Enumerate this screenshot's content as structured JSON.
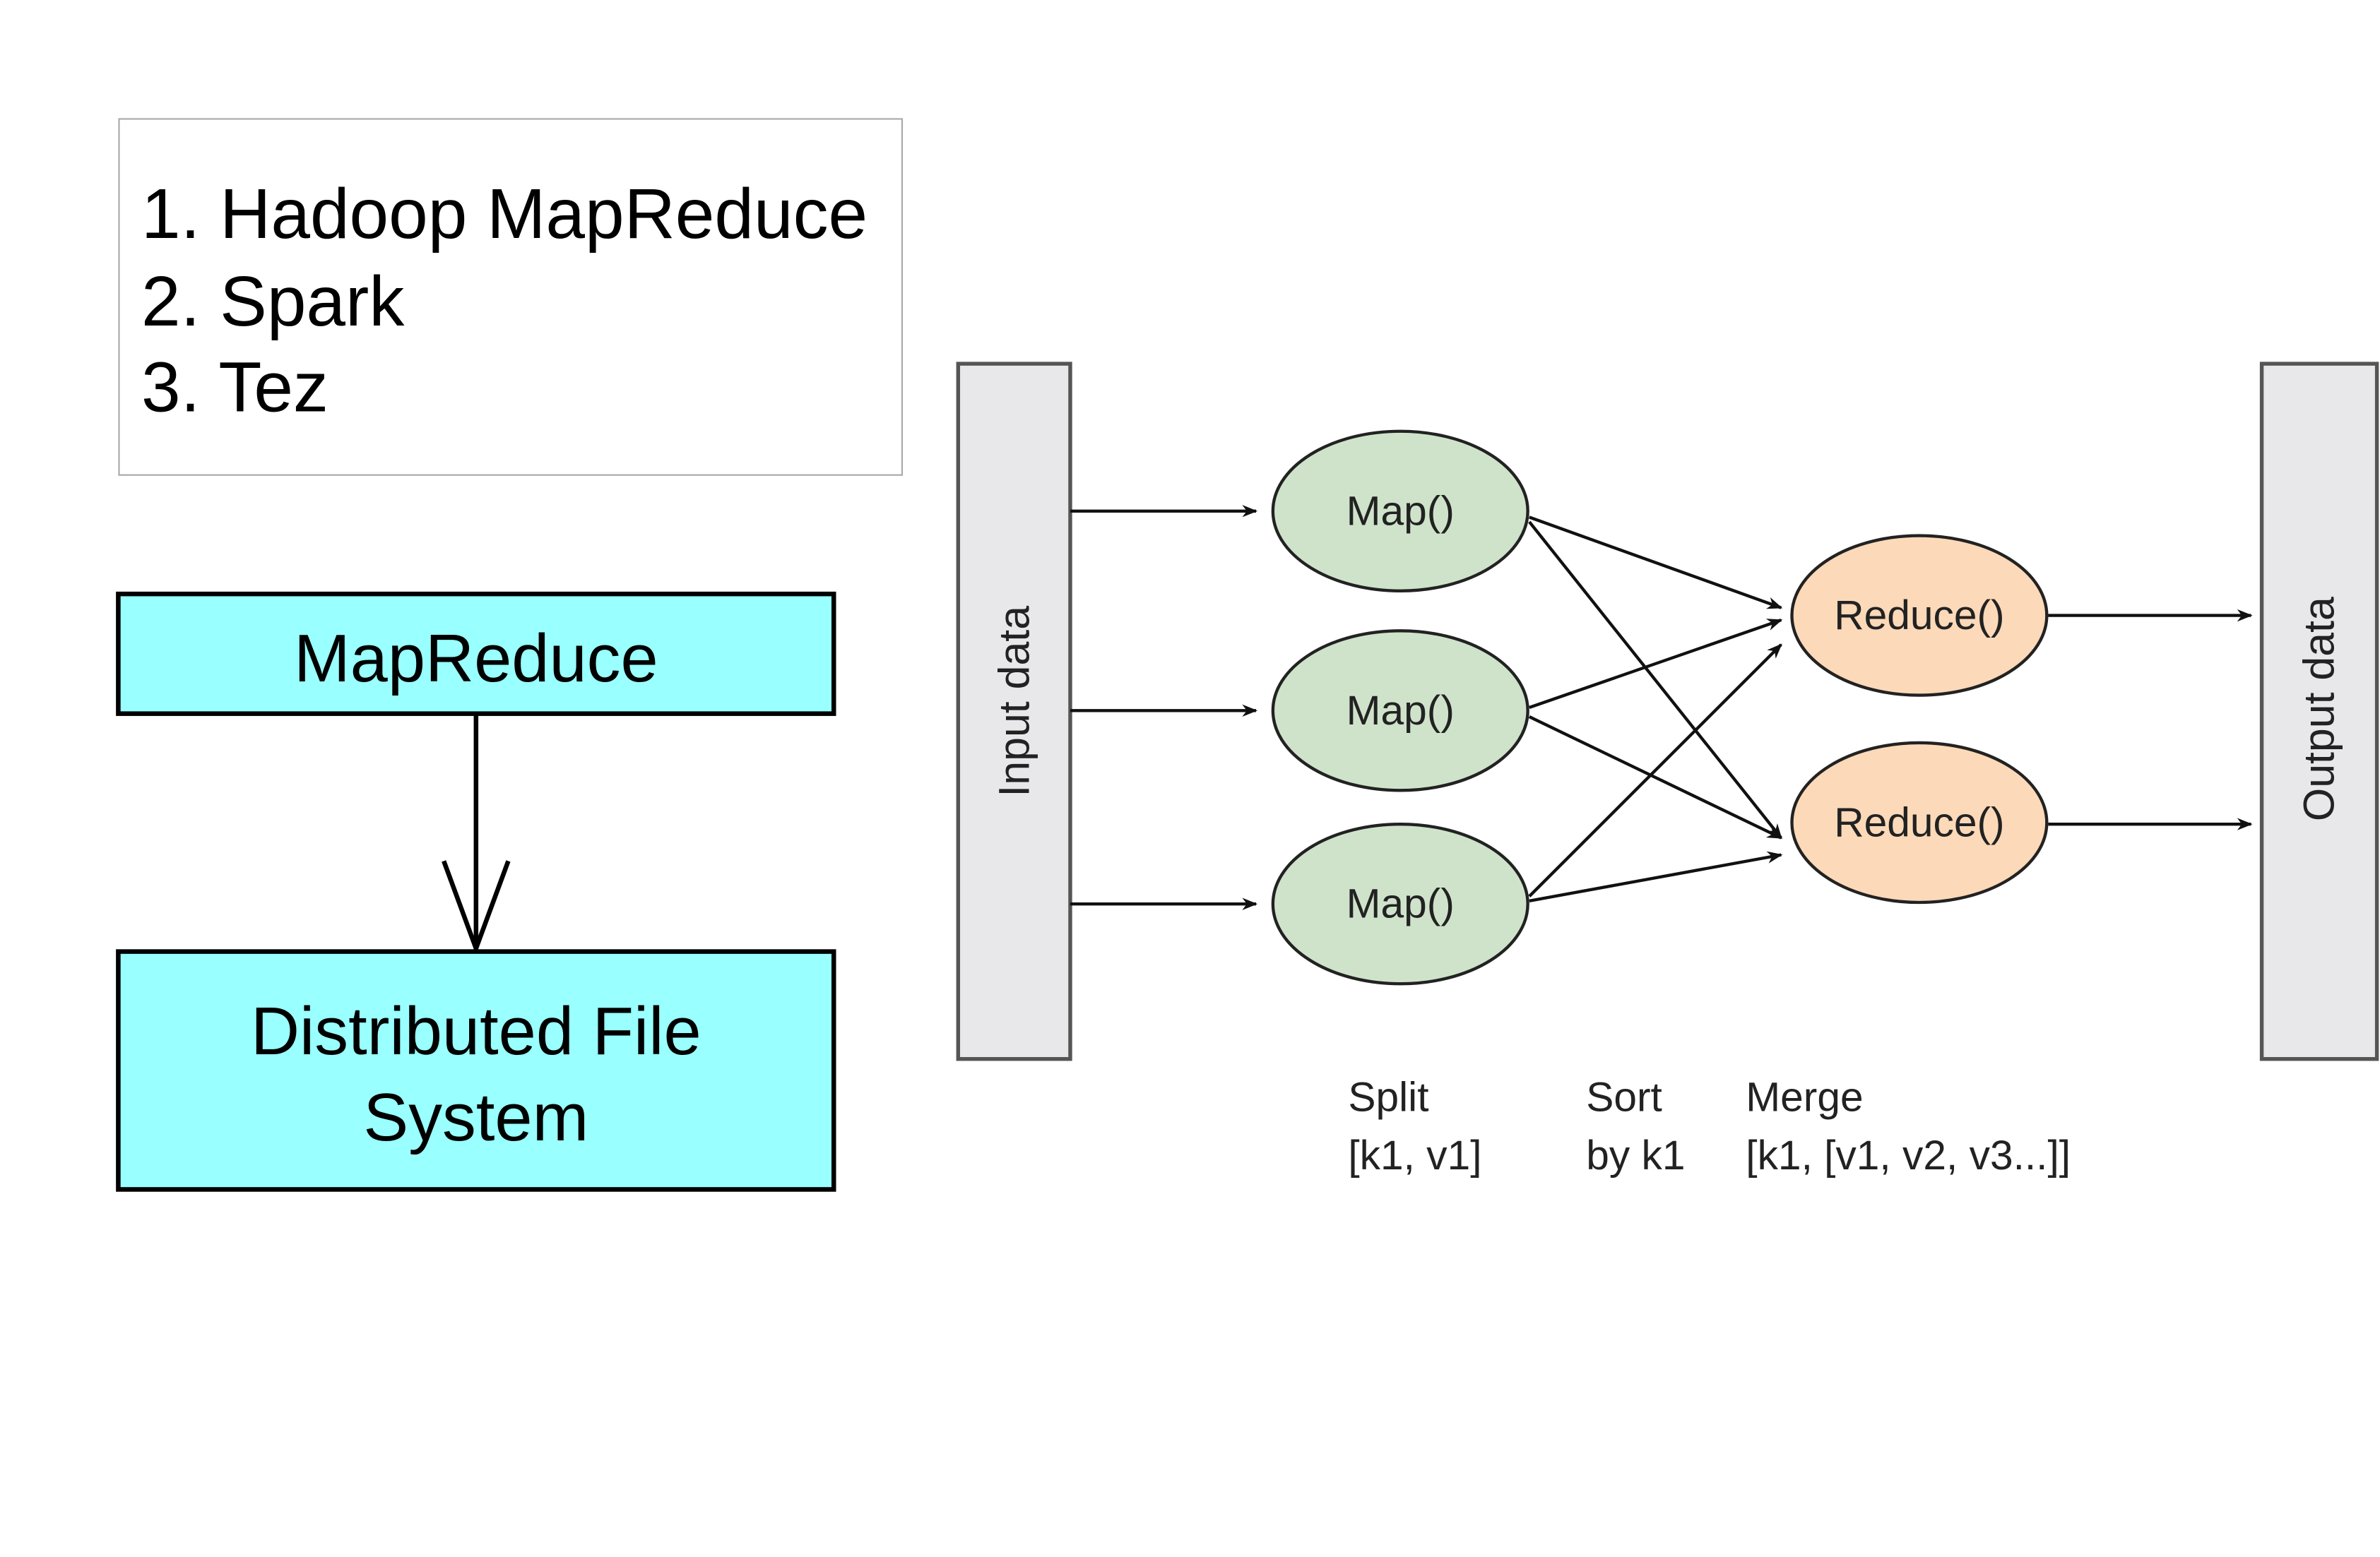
{
  "engine_list": {
    "items": [
      "1. Hadoop MapReduce",
      "2. Spark",
      "3. Tez"
    ]
  },
  "stack": {
    "top_label": "MapReduce",
    "bottom_label_lines": [
      "Distributed File",
      "System"
    ],
    "box_color": "#99ffff"
  },
  "flow": {
    "input_label": "Input data",
    "output_label": "Output data",
    "map_label": "Map()",
    "reduce_label": "Reduce()",
    "map_color": "#cfe3cb",
    "reduce_color": "#fcd9b8",
    "bar_color": "#e8e8ea",
    "stages": [
      {
        "line1": "Split",
        "line2": "[k1, v1]"
      },
      {
        "line1": "Sort",
        "line2": "by k1"
      },
      {
        "line1": "Merge",
        "line2": "[k1, [v1, v2, v3...]]"
      }
    ]
  }
}
